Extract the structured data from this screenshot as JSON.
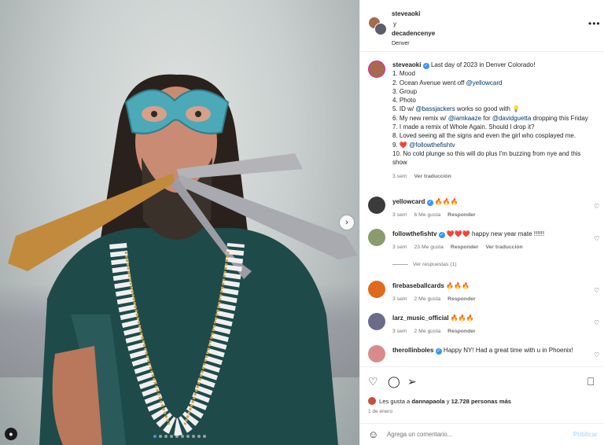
{
  "header": {
    "user1": "steveaoki",
    "conjunction": "y",
    "user2": "decadencenye",
    "location": "Denver",
    "more_icon": "more-horizontal-icon"
  },
  "caption": {
    "username": "steveaoki",
    "lines": [
      "Last day of 2023 in Denver Colorado!",
      "1. Mood",
      "2. Ocean Avenue went off ",
      "3. Group",
      "4. Photo",
      "5. ID w/ ",
      "6. My new remix w/ ",
      "7. I made a remix of Whole Again. Should I drop it?",
      "8. Loved seeing all the signs and even the girl who cosplayed me.",
      "9. ",
      "10. No cold plunge so this will do plus I'm buzzing from nye and this show"
    ],
    "mention_yellowcard": "@yellowcard",
    "mention_bassjackers": "@bassjackers",
    "line5_tail": " works so good with 💡",
    "mention_iamkaaze": "@iamkaaze",
    "line6_mid": " for ",
    "mention_davidguetta": "@davidguetta",
    "line6_tail": " dropping this Friday",
    "line9_heart": "❤️ ",
    "mention_followthefishtv": "@followthefishtv",
    "time": "3 sem",
    "translate": "Ver traducción"
  },
  "comments": [
    {
      "username": "yellowcard",
      "verified": true,
      "text": "🔥🔥🔥",
      "time": "3 sem",
      "likes": "6 Me gusta",
      "reply": "Responder",
      "avatar_color": "#3b3b3b"
    },
    {
      "username": "followthefishtv",
      "verified": true,
      "text": "❤️❤️❤️ happy new year mate !!!!!!",
      "time": "3 sem",
      "likes": "23 Me gusta",
      "reply": "Responder",
      "translate": "Ver traducción",
      "avatar_color": "#8a9b6e"
    },
    {
      "username": "firebaseballcards",
      "verified": false,
      "text": "🔥🔥🔥",
      "time": "3 sem",
      "likes": "2 Me gusta",
      "reply": "Responder",
      "avatar_color": "#e06a1b"
    },
    {
      "username": "larz_music_official",
      "verified": false,
      "text": "🔥🔥🔥",
      "time": "3 sem",
      "likes": "2 Me gusta",
      "reply": "Responder",
      "avatar_color": "#6b6b8a"
    },
    {
      "username": "therollinboles",
      "verified": true,
      "text": "Happy NY! Had a great time with u in Phoenix!",
      "avatar_color": "#d98b8b"
    }
  ],
  "view_replies": "Ver respuestas (1)",
  "likes": {
    "prefix": "Les gusta a ",
    "user": "dannapaola",
    "suffix": " y ",
    "count": "12.728 personas más"
  },
  "date": "1 de enero",
  "composer": {
    "placeholder": "Agrega un comentario...",
    "post_label": "Publicar"
  },
  "carousel": {
    "slides": 10,
    "active": 0
  },
  "icons": {
    "like": "heart-icon",
    "comment": "comment-icon",
    "share": "share-icon",
    "save": "bookmark-icon",
    "emoji": "emoji-icon"
  },
  "colors": {
    "verified": "#3897f0",
    "mention": "#00376b",
    "post_disabled": "#b2dffc"
  }
}
